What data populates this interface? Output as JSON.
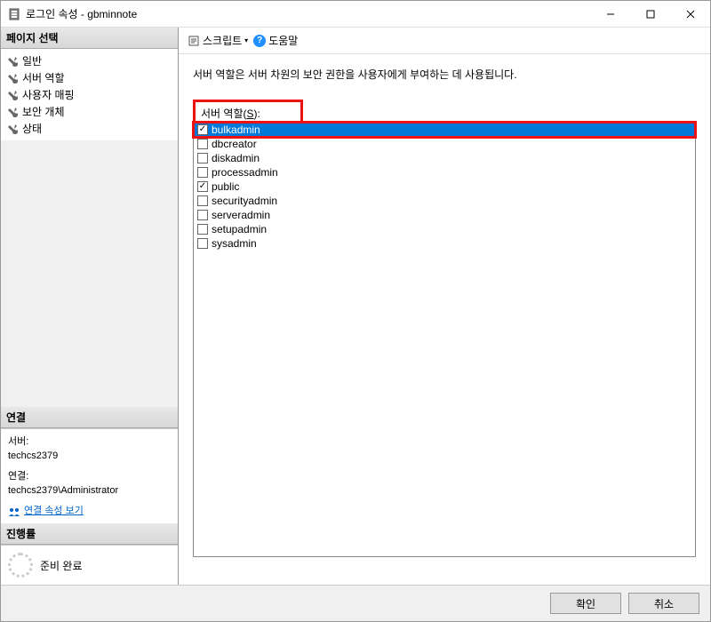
{
  "window": {
    "title": "로그인 속성 - gbminnote"
  },
  "sidebar": {
    "pageHeader": "페이지 선택",
    "pages": [
      {
        "label": "일반"
      },
      {
        "label": "서버 역할"
      },
      {
        "label": "사용자 매핑"
      },
      {
        "label": "보안 개체"
      },
      {
        "label": "상태"
      }
    ],
    "connectionHeader": "연결",
    "connection": {
      "serverLabel": "서버:",
      "serverValue": "techcs2379",
      "connLabel": "연결:",
      "connValue": "techcs2379\\Administrator",
      "viewLink": "연결 속성 보기"
    },
    "progressHeader": "진행률",
    "progressStatus": "준비 완료"
  },
  "toolbar": {
    "script": "스크립트",
    "help": "도움말"
  },
  "content": {
    "description": "서버 역할은 서버 차원의 보안 권한을 사용자에게 부여하는 데 사용됩니다.",
    "rolesLabelPrefix": "서버 역할(",
    "rolesLabelKey": "S",
    "rolesLabelSuffix": "):",
    "roles": [
      {
        "name": "bulkadmin",
        "checked": true,
        "selected": true,
        "highlighted": true
      },
      {
        "name": "dbcreator",
        "checked": false
      },
      {
        "name": "diskadmin",
        "checked": false
      },
      {
        "name": "processadmin",
        "checked": false
      },
      {
        "name": "public",
        "checked": true
      },
      {
        "name": "securityadmin",
        "checked": false
      },
      {
        "name": "serveradmin",
        "checked": false
      },
      {
        "name": "setupadmin",
        "checked": false
      },
      {
        "name": "sysadmin",
        "checked": false
      }
    ]
  },
  "footer": {
    "ok": "확인",
    "cancel": "취소"
  }
}
